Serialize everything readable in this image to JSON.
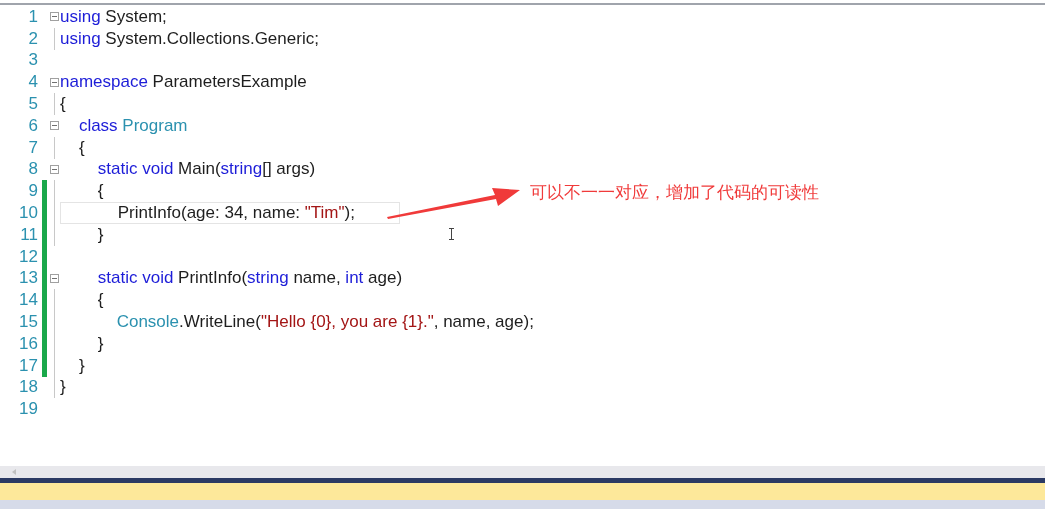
{
  "editor": {
    "lines": [
      {
        "number": "1",
        "changed": false,
        "fold": true,
        "current": false,
        "tokens": [
          {
            "kind": "keyword",
            "text": "using"
          },
          {
            "kind": "plain",
            "text": " System;"
          }
        ]
      },
      {
        "number": "2",
        "changed": false,
        "fold": false,
        "current": false,
        "tokens": [
          {
            "kind": "keyword",
            "text": "using"
          },
          {
            "kind": "plain",
            "text": " System.Collections.Generic;"
          }
        ]
      },
      {
        "number": "3",
        "changed": false,
        "fold": false,
        "current": false
      },
      {
        "number": "4",
        "changed": false,
        "fold": true,
        "current": false,
        "tokens": [
          {
            "kind": "keyword",
            "text": "namespace"
          },
          {
            "kind": "plain",
            "text": " ParametersExample"
          }
        ]
      },
      {
        "number": "5",
        "changed": false,
        "fold": false,
        "current": false,
        "tokens": [
          {
            "kind": "plain",
            "text": "{"
          }
        ]
      },
      {
        "number": "6",
        "changed": false,
        "fold": true,
        "current": false,
        "tokens": [
          {
            "kind": "keyword",
            "text": "    class"
          },
          {
            "kind": "type",
            "text": " Program"
          }
        ]
      },
      {
        "number": "7",
        "changed": false,
        "fold": false,
        "current": false,
        "tokens": [
          {
            "kind": "plain",
            "text": "    {"
          }
        ]
      },
      {
        "number": "8",
        "changed": false,
        "fold": true,
        "current": false,
        "tokens": [
          {
            "kind": "keyword",
            "text": "        static void"
          },
          {
            "kind": "plain",
            "text": " Main("
          },
          {
            "kind": "keyword",
            "text": "string"
          },
          {
            "kind": "plain",
            "text": "[] args)"
          }
        ]
      },
      {
        "number": "9",
        "changed": true,
        "fold": false,
        "current": false,
        "tokens": [
          {
            "kind": "plain",
            "text": "        {"
          }
        ]
      },
      {
        "number": "10",
        "changed": true,
        "fold": false,
        "current": true,
        "tokens": [
          {
            "kind": "plain",
            "text": "            PrintInfo(age: 34, name: "
          },
          {
            "kind": "string",
            "text": "\"Tim\""
          },
          {
            "kind": "plain",
            "text": ");"
          }
        ]
      },
      {
        "number": "11",
        "changed": true,
        "fold": false,
        "current": false,
        "tokens": [
          {
            "kind": "plain",
            "text": "        }"
          }
        ]
      },
      {
        "number": "12",
        "changed": true,
        "fold": false,
        "current": false
      },
      {
        "number": "13",
        "changed": true,
        "fold": true,
        "current": false,
        "tokens": [
          {
            "kind": "keyword",
            "text": "        static void"
          },
          {
            "kind": "plain",
            "text": " PrintInfo("
          },
          {
            "kind": "keyword",
            "text": "string"
          },
          {
            "kind": "plain",
            "text": " name, "
          },
          {
            "kind": "keyword",
            "text": "int"
          },
          {
            "kind": "plain",
            "text": " age)"
          }
        ]
      },
      {
        "number": "14",
        "changed": true,
        "fold": false,
        "current": false,
        "tokens": [
          {
            "kind": "plain",
            "text": "        {"
          }
        ]
      },
      {
        "number": "15",
        "changed": true,
        "fold": false,
        "current": false,
        "tokens": [
          {
            "kind": "type",
            "text": "            Console"
          },
          {
            "kind": "plain",
            "text": ".WriteLine("
          },
          {
            "kind": "string",
            "text": "\"Hello {0}, you are {1}.\""
          },
          {
            "kind": "plain",
            "text": ", name, age);"
          }
        ]
      },
      {
        "number": "16",
        "changed": true,
        "fold": false,
        "current": false,
        "tokens": [
          {
            "kind": "plain",
            "text": "        }"
          }
        ]
      },
      {
        "number": "17",
        "changed": true,
        "fold": false,
        "current": false,
        "tokens": [
          {
            "kind": "plain",
            "text": "    }"
          }
        ]
      },
      {
        "number": "18",
        "changed": false,
        "fold": false,
        "current": false,
        "tokens": [
          {
            "kind": "plain",
            "text": "}"
          }
        ]
      },
      {
        "number": "19",
        "changed": false,
        "fold": false,
        "current": false
      }
    ]
  },
  "annotation": {
    "text": "可以不一一对应，增加了代码的可读性"
  }
}
